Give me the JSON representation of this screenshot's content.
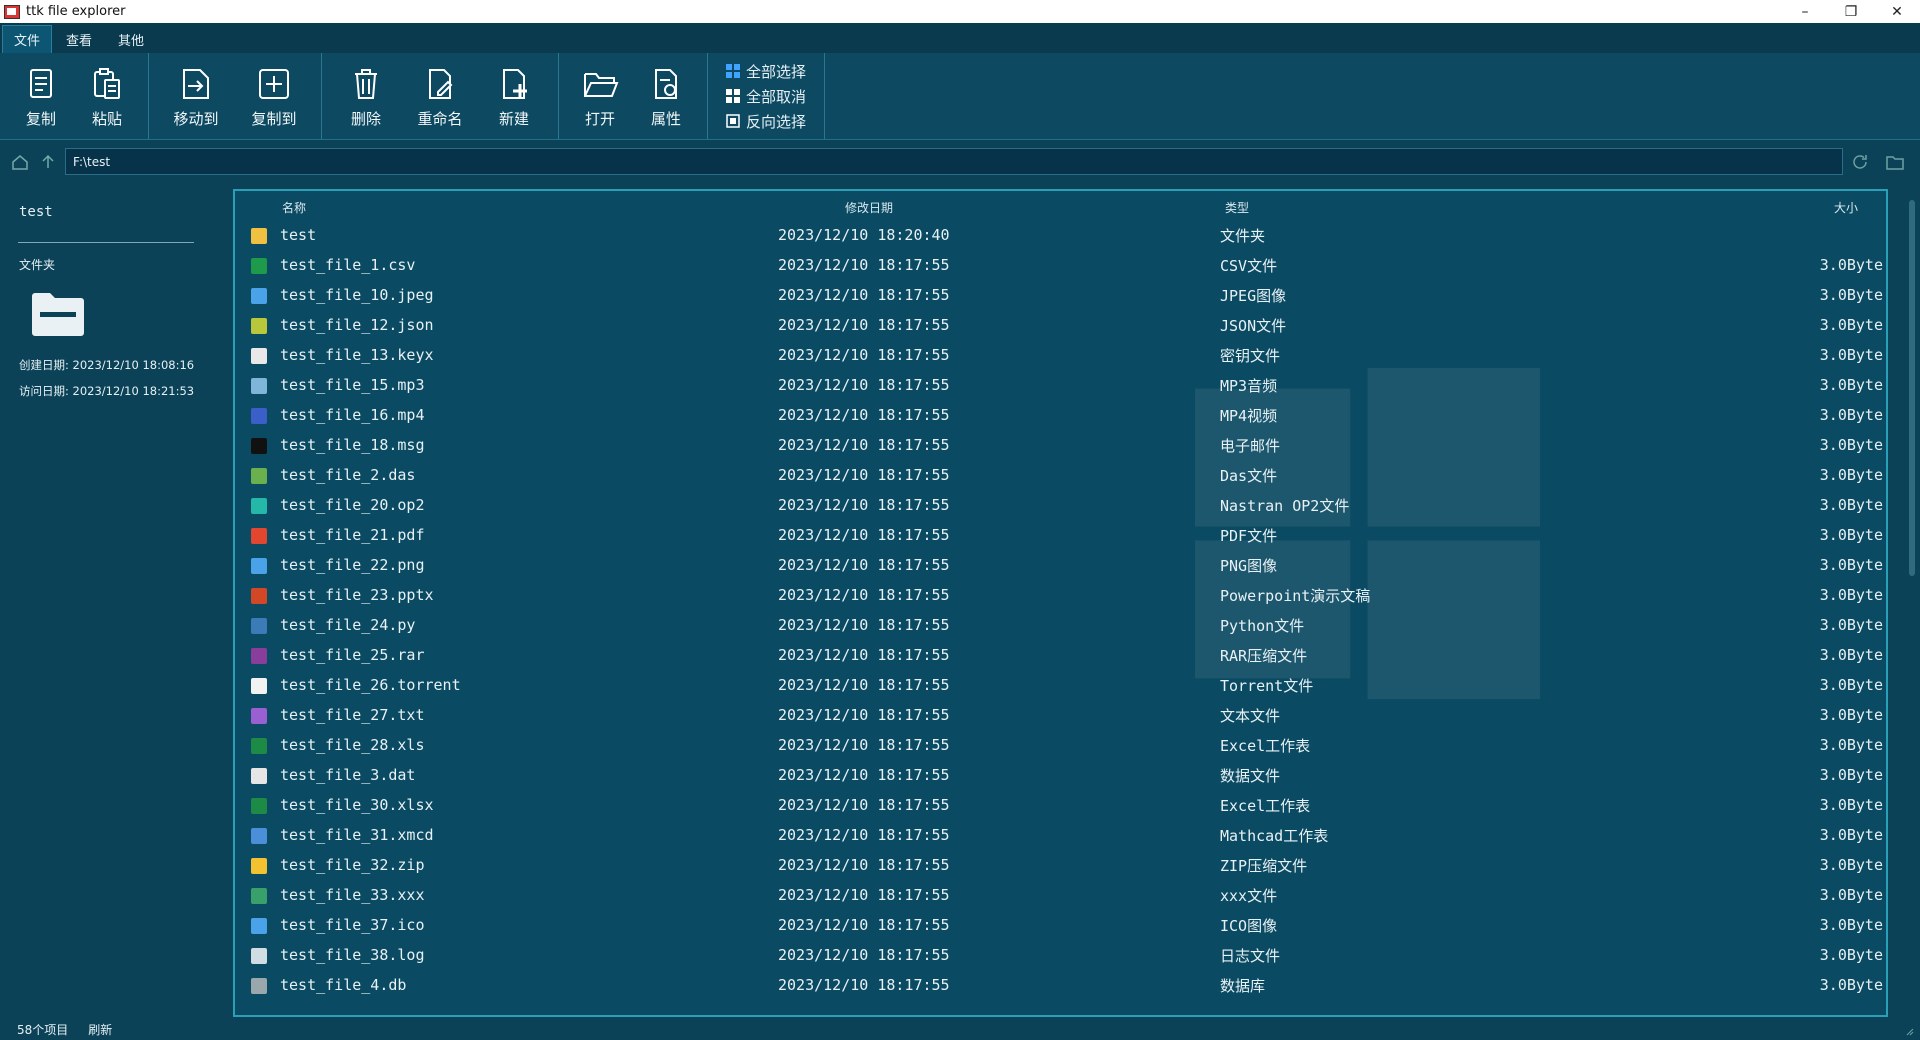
{
  "window": {
    "title": "ttk file explorer",
    "controls": [
      "–",
      "❐",
      "✕"
    ]
  },
  "menu": {
    "tabs": [
      "文件",
      "查看",
      "其他"
    ],
    "active": 0
  },
  "ribbon": {
    "copy": "复制",
    "paste": "粘贴",
    "move_to": "移动到",
    "copy_to": "复制到",
    "delete": "删除",
    "rename": "重命名",
    "new": "新建",
    "open": "打开",
    "properties": "属性",
    "select_all": "全部选择",
    "select_none": "全部取消",
    "invert_selection": "反向选择"
  },
  "address": {
    "path": "F:\\test"
  },
  "left_panel": {
    "name": "test",
    "type": "文件夹",
    "created": "创建日期: 2023/12/10 18:08:16",
    "visited": "访问日期: 2023/12/10 18:21:53"
  },
  "columns": {
    "name": "名称",
    "modified": "修改日期",
    "type": "类型",
    "size": "大小"
  },
  "files": [
    {
      "name": "test",
      "date": "2023/12/10 18:20:40",
      "type": "文件夹",
      "size": "",
      "icon": "folder-icon",
      "color": "#f0c040"
    },
    {
      "name": "test_file_1.csv",
      "date": "2023/12/10 18:17:55",
      "type": "CSV文件",
      "size": "3.0Byte",
      "icon": "csv-icon",
      "color": "#1d9a4a"
    },
    {
      "name": "test_file_10.jpeg",
      "date": "2023/12/10 18:17:55",
      "type": "JPEG图像",
      "size": "3.0Byte",
      "icon": "image-icon",
      "color": "#4aa3e8"
    },
    {
      "name": "test_file_12.json",
      "date": "2023/12/10 18:17:55",
      "type": "JSON文件",
      "size": "3.0Byte",
      "icon": "json-icon",
      "color": "#b8c83a"
    },
    {
      "name": "test_file_13.keyx",
      "date": "2023/12/10 18:17:55",
      "type": "密钥文件",
      "size": "3.0Byte",
      "icon": "key-file-icon",
      "color": "#e9e9e9"
    },
    {
      "name": "test_file_15.mp3",
      "date": "2023/12/10 18:17:55",
      "type": "MP3音频",
      "size": "3.0Byte",
      "icon": "audio-icon",
      "color": "#7fb5d8"
    },
    {
      "name": "test_file_16.mp4",
      "date": "2023/12/10 18:17:55",
      "type": "MP4视频",
      "size": "3.0Byte",
      "icon": "video-icon",
      "color": "#3a5fc8"
    },
    {
      "name": "test_file_18.msg",
      "date": "2023/12/10 18:17:55",
      "type": "电子邮件",
      "size": "3.0Byte",
      "icon": "mail-icon",
      "color": "#111111"
    },
    {
      "name": "test_file_2.das",
      "date": "2023/12/10 18:17:55",
      "type": "Das文件",
      "size": "3.0Byte",
      "icon": "das-icon",
      "color": "#6ab04c"
    },
    {
      "name": "test_file_20.op2",
      "date": "2023/12/10 18:17:55",
      "type": "Nastran OP2文件",
      "size": "3.0Byte",
      "icon": "nastran-icon",
      "color": "#25b7a8"
    },
    {
      "name": "test_file_21.pdf",
      "date": "2023/12/10 18:17:55",
      "type": "PDF文件",
      "size": "3.0Byte",
      "icon": "pdf-icon",
      "color": "#e2462f"
    },
    {
      "name": "test_file_22.png",
      "date": "2023/12/10 18:17:55",
      "type": "PNG图像",
      "size": "3.0Byte",
      "icon": "image-icon",
      "color": "#4aa3e8"
    },
    {
      "name": "test_file_23.pptx",
      "date": "2023/12/10 18:17:55",
      "type": "Powerpoint演示文稿",
      "size": "3.0Byte",
      "icon": "powerpoint-icon",
      "color": "#d24726"
    },
    {
      "name": "test_file_24.py",
      "date": "2023/12/10 18:17:55",
      "type": "Python文件",
      "size": "3.0Byte",
      "icon": "python-icon",
      "color": "#3d7ab8"
    },
    {
      "name": "test_file_25.rar",
      "date": "2023/12/10 18:17:55",
      "type": "RAR压缩文件",
      "size": "3.0Byte",
      "icon": "rar-icon",
      "color": "#8a3e9c"
    },
    {
      "name": "test_file_26.torrent",
      "date": "2023/12/10 18:17:55",
      "type": "Torrent文件",
      "size": "3.0Byte",
      "icon": "torrent-icon",
      "color": "#f2f2f2"
    },
    {
      "name": "test_file_27.txt",
      "date": "2023/12/10 18:17:55",
      "type": "文本文件",
      "size": "3.0Byte",
      "icon": "text-icon",
      "color": "#9a5fd0"
    },
    {
      "name": "test_file_28.xls",
      "date": "2023/12/10 18:17:55",
      "type": "Excel工作表",
      "size": "3.0Byte",
      "icon": "excel-icon",
      "color": "#1d8a46"
    },
    {
      "name": "test_file_3.dat",
      "date": "2023/12/10 18:17:55",
      "type": "数据文件",
      "size": "3.0Byte",
      "icon": "data-file-icon",
      "color": "#e6e6e6"
    },
    {
      "name": "test_file_30.xlsx",
      "date": "2023/12/10 18:17:55",
      "type": "Excel工作表",
      "size": "3.0Byte",
      "icon": "excel-icon",
      "color": "#1d8a46"
    },
    {
      "name": "test_file_31.xmcd",
      "date": "2023/12/10 18:17:55",
      "type": "Mathcad工作表",
      "size": "3.0Byte",
      "icon": "mathcad-icon",
      "color": "#4a8fd8"
    },
    {
      "name": "test_file_32.zip",
      "date": "2023/12/10 18:17:55",
      "type": "ZIP压缩文件",
      "size": "3.0Byte",
      "icon": "zip-icon",
      "color": "#f2c230"
    },
    {
      "name": "test_file_33.xxx",
      "date": "2023/12/10 18:17:55",
      "type": "xxx文件",
      "size": "3.0Byte",
      "icon": "feather-icon",
      "color": "#3aa06a"
    },
    {
      "name": "test_file_37.ico",
      "date": "2023/12/10 18:17:55",
      "type": "ICO图像",
      "size": "3.0Byte",
      "icon": "image-icon",
      "color": "#4aa3e8"
    },
    {
      "name": "test_file_38.log",
      "date": "2023/12/10 18:17:55",
      "type": "日志文件",
      "size": "3.0Byte",
      "icon": "log-icon",
      "color": "#d0dde3"
    },
    {
      "name": "test_file_4.db",
      "date": "2023/12/10 18:17:55",
      "type": "数据库",
      "size": "3.0Byte",
      "icon": "database-icon",
      "color": "#9aa7ad"
    }
  ],
  "status": {
    "count": "58个项目",
    "refresh": "刷新"
  }
}
